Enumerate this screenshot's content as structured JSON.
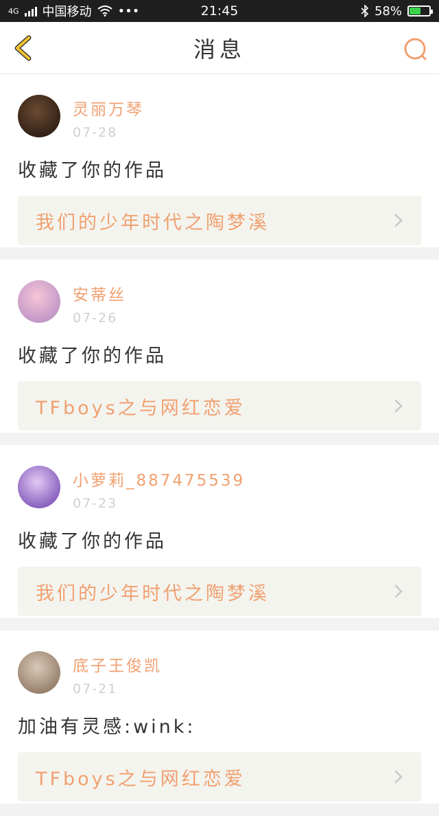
{
  "status_bar": {
    "network": "4G",
    "carrier": "中国移动",
    "dots": "•••",
    "time": "21:45",
    "battery_percent": "58%",
    "battery_level": 0.58
  },
  "nav": {
    "title": "消息",
    "back_icon": "chevron-left-icon",
    "search_icon": "search-icon"
  },
  "colors": {
    "accent": "#f0a070",
    "back_icon": "#f2c32d"
  },
  "messages": [
    {
      "username": "灵丽万琴",
      "date": "07-28",
      "action": "收藏了你的作品",
      "work_title": "我们的少年时代之陶梦溪",
      "avatar_colors": [
        "#6b4a32",
        "#2a1b12"
      ]
    },
    {
      "username": "安蒂丝",
      "date": "07-26",
      "action": "收藏了你的作品",
      "work_title": "TFboys之与网红恋爱",
      "avatar_colors": [
        "#f6c6d8",
        "#b98fc4"
      ]
    },
    {
      "username": "小萝莉_887475539",
      "date": "07-23",
      "action": "收藏了你的作品",
      "work_title": "我们的少年时代之陶梦溪",
      "avatar_colors": [
        "#e3c8f4",
        "#7a4fb5"
      ]
    },
    {
      "username": "底子王俊凯",
      "date": "07-21",
      "action": "加油有灵感:wink:",
      "work_title": "TFboys之与网红恋爱",
      "avatar_colors": [
        "#d9c9b8",
        "#8d7560"
      ]
    }
  ]
}
